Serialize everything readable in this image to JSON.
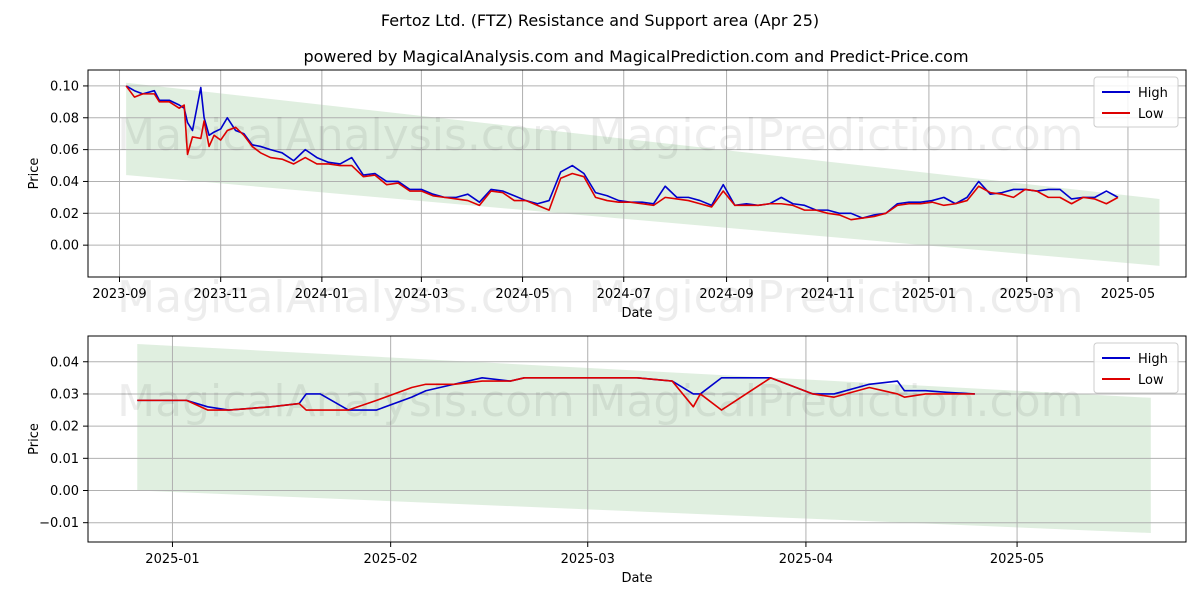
{
  "title": "Fertoz Ltd. (FTZ) Resistance and Support area (Apr 25)",
  "subtitle": "powered by MagicalAnalysis.com and MagicalPrediction.com and Predict-Price.com",
  "watermarks": [
    "MagicalAnalysis.com",
    "MagicalPrediction.com"
  ],
  "colors": {
    "high": "#0000cc",
    "low": "#dd0000",
    "band": "#d5ead5",
    "grid": "#b0b0b0"
  },
  "chart_data": [
    {
      "type": "line",
      "xlabel": "Date",
      "ylabel": "Price",
      "xlim": [
        "2023-08-13",
        "2025-06-05"
      ],
      "ylim": [
        -0.02,
        0.11
      ],
      "x_ticks": [
        {
          "date": "2023-09-01",
          "label": "2023-09"
        },
        {
          "date": "2023-11-01",
          "label": "2023-11"
        },
        {
          "date": "2024-01-01",
          "label": "2024-01"
        },
        {
          "date": "2024-03-01",
          "label": "2024-03"
        },
        {
          "date": "2024-05-01",
          "label": "2024-05"
        },
        {
          "date": "2024-07-01",
          "label": "2024-07"
        },
        {
          "date": "2024-09-01",
          "label": "2024-09"
        },
        {
          "date": "2024-11-01",
          "label": "2024-11"
        },
        {
          "date": "2025-01-01",
          "label": "2025-01"
        },
        {
          "date": "2025-03-01",
          "label": "2025-03"
        },
        {
          "date": "2025-05-01",
          "label": "2025-05"
        }
      ],
      "y_ticks": [
        {
          "value": 0.0,
          "label": "0.00"
        },
        {
          "value": 0.02,
          "label": "0.02"
        },
        {
          "value": 0.04,
          "label": "0.04"
        },
        {
          "value": 0.06,
          "label": "0.06"
        },
        {
          "value": 0.08,
          "label": "0.08"
        },
        {
          "value": 0.1,
          "label": "0.10"
        }
      ],
      "grid": true,
      "legend": "top-right",
      "band": {
        "start": "2023-09-05",
        "end": "2025-05-20",
        "upper": [
          0.102,
          0.029
        ],
        "lower": [
          0.044,
          -0.013
        ]
      },
      "series": [
        {
          "name": "High",
          "x": [
            "2023-09-05",
            "2023-09-10",
            "2023-09-15",
            "2023-09-22",
            "2023-09-25",
            "2023-10-01",
            "2023-10-07",
            "2023-10-10",
            "2023-10-12",
            "2023-10-15",
            "2023-10-20",
            "2023-10-22",
            "2023-10-25",
            "2023-10-28",
            "2023-11-01",
            "2023-11-05",
            "2023-11-10",
            "2023-11-15",
            "2023-11-20",
            "2023-11-25",
            "2023-12-01",
            "2023-12-08",
            "2023-12-15",
            "2023-12-22",
            "2023-12-29",
            "2024-01-05",
            "2024-01-12",
            "2024-01-19",
            "2024-01-26",
            "2024-02-02",
            "2024-02-09",
            "2024-02-16",
            "2024-02-23",
            "2024-03-01",
            "2024-03-08",
            "2024-03-15",
            "2024-03-22",
            "2024-03-29",
            "2024-04-05",
            "2024-04-12",
            "2024-04-19",
            "2024-04-26",
            "2024-05-03",
            "2024-05-10",
            "2024-05-17",
            "2024-05-24",
            "2024-05-31",
            "2024-06-07",
            "2024-06-14",
            "2024-06-21",
            "2024-06-28",
            "2024-07-05",
            "2024-07-12",
            "2024-07-19",
            "2024-07-26",
            "2024-08-02",
            "2024-08-09",
            "2024-08-16",
            "2024-08-23",
            "2024-08-30",
            "2024-09-06",
            "2024-09-13",
            "2024-09-20",
            "2024-09-27",
            "2024-10-04",
            "2024-10-11",
            "2024-10-18",
            "2024-10-25",
            "2024-11-01",
            "2024-11-08",
            "2024-11-15",
            "2024-11-22",
            "2024-11-29",
            "2024-12-06",
            "2024-12-13",
            "2024-12-20",
            "2024-12-27",
            "2025-01-03",
            "2025-01-10",
            "2025-01-17",
            "2025-01-24",
            "2025-01-31",
            "2025-02-07",
            "2025-02-14",
            "2025-02-21",
            "2025-02-28",
            "2025-03-07",
            "2025-03-14",
            "2025-03-21",
            "2025-03-28",
            "2025-04-04",
            "2025-04-11",
            "2025-04-18",
            "2025-04-25"
          ],
          "y": [
            0.1,
            0.097,
            0.095,
            0.097,
            0.091,
            0.091,
            0.088,
            0.086,
            0.077,
            0.072,
            0.099,
            0.08,
            0.069,
            0.071,
            0.073,
            0.08,
            0.072,
            0.07,
            0.063,
            0.062,
            0.06,
            0.058,
            0.053,
            0.06,
            0.055,
            0.052,
            0.051,
            0.055,
            0.044,
            0.045,
            0.04,
            0.04,
            0.035,
            0.035,
            0.032,
            0.03,
            0.03,
            0.032,
            0.027,
            0.035,
            0.034,
            0.031,
            0.028,
            0.026,
            0.028,
            0.046,
            0.05,
            0.045,
            0.033,
            0.031,
            0.028,
            0.027,
            0.027,
            0.026,
            0.037,
            0.03,
            0.03,
            0.028,
            0.025,
            0.038,
            0.025,
            0.026,
            0.025,
            0.026,
            0.03,
            0.026,
            0.025,
            0.022,
            0.022,
            0.02,
            0.02,
            0.017,
            0.019,
            0.02,
            0.026,
            0.027,
            0.027,
            0.028,
            0.03,
            0.026,
            0.03,
            0.04,
            0.032,
            0.033,
            0.035,
            0.035,
            0.034,
            0.035,
            0.035,
            0.029,
            0.03,
            0.03,
            0.034,
            0.03
          ]
        },
        {
          "name": "Low",
          "x": [
            "2023-09-05",
            "2023-09-10",
            "2023-09-15",
            "2023-09-22",
            "2023-09-25",
            "2023-10-01",
            "2023-10-07",
            "2023-10-10",
            "2023-10-12",
            "2023-10-15",
            "2023-10-20",
            "2023-10-22",
            "2023-10-25",
            "2023-10-28",
            "2023-11-01",
            "2023-11-05",
            "2023-11-10",
            "2023-11-15",
            "2023-11-20",
            "2023-11-25",
            "2023-12-01",
            "2023-12-08",
            "2023-12-15",
            "2023-12-22",
            "2023-12-29",
            "2024-01-05",
            "2024-01-12",
            "2024-01-19",
            "2024-01-26",
            "2024-02-02",
            "2024-02-09",
            "2024-02-16",
            "2024-02-23",
            "2024-03-01",
            "2024-03-08",
            "2024-03-15",
            "2024-03-22",
            "2024-03-29",
            "2024-04-05",
            "2024-04-12",
            "2024-04-19",
            "2024-04-26",
            "2024-05-03",
            "2024-05-10",
            "2024-05-17",
            "2024-05-24",
            "2024-05-31",
            "2024-06-07",
            "2024-06-14",
            "2024-06-21",
            "2024-06-28",
            "2024-07-05",
            "2024-07-12",
            "2024-07-19",
            "2024-07-26",
            "2024-08-02",
            "2024-08-09",
            "2024-08-16",
            "2024-08-23",
            "2024-08-30",
            "2024-09-06",
            "2024-09-13",
            "2024-09-20",
            "2024-09-27",
            "2024-10-04",
            "2024-10-11",
            "2024-10-18",
            "2024-10-25",
            "2024-11-01",
            "2024-11-08",
            "2024-11-15",
            "2024-11-22",
            "2024-11-29",
            "2024-12-06",
            "2024-12-13",
            "2024-12-20",
            "2024-12-27",
            "2025-01-03",
            "2025-01-10",
            "2025-01-17",
            "2025-01-24",
            "2025-01-31",
            "2025-02-07",
            "2025-02-14",
            "2025-02-21",
            "2025-02-28",
            "2025-03-07",
            "2025-03-14",
            "2025-03-21",
            "2025-03-28",
            "2025-04-04",
            "2025-04-11",
            "2025-04-18",
            "2025-04-25"
          ],
          "y": [
            0.1,
            0.093,
            0.095,
            0.095,
            0.09,
            0.09,
            0.086,
            0.088,
            0.057,
            0.068,
            0.067,
            0.078,
            0.062,
            0.069,
            0.066,
            0.072,
            0.074,
            0.069,
            0.062,
            0.058,
            0.055,
            0.054,
            0.051,
            0.055,
            0.051,
            0.051,
            0.05,
            0.05,
            0.043,
            0.044,
            0.038,
            0.039,
            0.034,
            0.034,
            0.031,
            0.03,
            0.029,
            0.028,
            0.025,
            0.034,
            0.033,
            0.028,
            0.028,
            0.025,
            0.022,
            0.042,
            0.045,
            0.043,
            0.03,
            0.028,
            0.027,
            0.027,
            0.026,
            0.025,
            0.03,
            0.029,
            0.028,
            0.026,
            0.024,
            0.034,
            0.025,
            0.025,
            0.025,
            0.026,
            0.026,
            0.025,
            0.022,
            0.022,
            0.02,
            0.019,
            0.016,
            0.017,
            0.018,
            0.02,
            0.025,
            0.026,
            0.026,
            0.027,
            0.025,
            0.026,
            0.028,
            0.037,
            0.033,
            0.032,
            0.03,
            0.035,
            0.034,
            0.03,
            0.03,
            0.026,
            0.03,
            0.029,
            0.026,
            0.03
          ]
        }
      ]
    },
    {
      "type": "line",
      "xlabel": "Date",
      "ylabel": "Price",
      "xlim": [
        "2024-12-20",
        "2025-05-25"
      ],
      "ylim": [
        -0.016,
        0.048
      ],
      "x_ticks": [
        {
          "date": "2025-01-01",
          "label": "2025-01"
        },
        {
          "date": "2025-02-01",
          "label": "2025-02"
        },
        {
          "date": "2025-03-01",
          "label": "2025-03"
        },
        {
          "date": "2025-04-01",
          "label": "2025-04"
        },
        {
          "date": "2025-05-01",
          "label": "2025-05"
        }
      ],
      "y_ticks": [
        {
          "value": -0.01,
          "label": "−0.01"
        },
        {
          "value": 0.0,
          "label": "0.00"
        },
        {
          "value": 0.01,
          "label": "0.01"
        },
        {
          "value": 0.02,
          "label": "0.02"
        },
        {
          "value": 0.03,
          "label": "0.03"
        },
        {
          "value": 0.04,
          "label": "0.04"
        }
      ],
      "grid": true,
      "legend": "top-right",
      "band": {
        "start": "2024-12-27",
        "end": "2025-05-20",
        "upper": [
          0.0455,
          0.0288
        ],
        "lower": [
          0.0,
          -0.0132
        ]
      },
      "series": [
        {
          "name": "High",
          "x": [
            "2024-12-27",
            "2025-01-03",
            "2025-01-06",
            "2025-01-09",
            "2025-01-15",
            "2025-01-19",
            "2025-01-20",
            "2025-01-22",
            "2025-01-26",
            "2025-01-30",
            "2025-02-04",
            "2025-02-06",
            "2025-02-10",
            "2025-02-14",
            "2025-02-18",
            "2025-02-20",
            "2025-02-23",
            "2025-03-01",
            "2025-03-08",
            "2025-03-13",
            "2025-03-16",
            "2025-03-17",
            "2025-03-20",
            "2025-03-27",
            "2025-04-02",
            "2025-04-05",
            "2025-04-10",
            "2025-04-14",
            "2025-04-15",
            "2025-04-18",
            "2025-04-21",
            "2025-04-25"
          ],
          "y": [
            0.028,
            0.028,
            0.026,
            0.025,
            0.026,
            0.027,
            0.03,
            0.03,
            0.025,
            0.025,
            0.029,
            0.031,
            0.033,
            0.035,
            0.034,
            0.035,
            0.035,
            0.035,
            0.035,
            0.034,
            0.03,
            0.03,
            0.035,
            0.035,
            0.03,
            0.03,
            0.033,
            0.034,
            0.031,
            0.031,
            0.0305,
            0.03
          ]
        },
        {
          "name": "Low",
          "x": [
            "2024-12-27",
            "2025-01-03",
            "2025-01-06",
            "2025-01-09",
            "2025-01-15",
            "2025-01-19",
            "2025-01-20",
            "2025-01-22",
            "2025-01-26",
            "2025-01-30",
            "2025-02-04",
            "2025-02-06",
            "2025-02-10",
            "2025-02-14",
            "2025-02-18",
            "2025-02-20",
            "2025-02-23",
            "2025-03-01",
            "2025-03-08",
            "2025-03-13",
            "2025-03-16",
            "2025-03-17",
            "2025-03-20",
            "2025-03-27",
            "2025-04-02",
            "2025-04-05",
            "2025-04-10",
            "2025-04-14",
            "2025-04-15",
            "2025-04-18",
            "2025-04-21",
            "2025-04-25"
          ],
          "y": [
            0.028,
            0.028,
            0.025,
            0.025,
            0.026,
            0.027,
            0.025,
            0.025,
            0.025,
            0.028,
            0.032,
            0.033,
            0.033,
            0.034,
            0.034,
            0.035,
            0.035,
            0.035,
            0.035,
            0.034,
            0.026,
            0.03,
            0.025,
            0.035,
            0.03,
            0.029,
            0.032,
            0.03,
            0.029,
            0.03,
            0.03,
            0.03
          ]
        }
      ]
    }
  ]
}
